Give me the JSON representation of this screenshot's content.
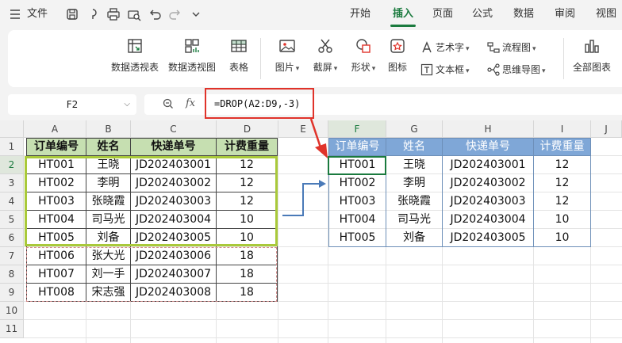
{
  "menubar": {
    "file_label": "文件",
    "tabs": [
      "开始",
      "插入",
      "页面",
      "公式",
      "数据",
      "审阅",
      "视图"
    ],
    "active_tab": "插入"
  },
  "ribbon": {
    "pivot_table": "数据透视表",
    "pivot_chart": "数据透视图",
    "table": "表格",
    "picture": "图片",
    "screenshot": "截屏",
    "shape": "形状",
    "icon": "图标",
    "wordart": "艺术字",
    "textbox": "文本框",
    "flowchart": "流程图",
    "mindmap": "思维导图",
    "all_charts": "全部图表"
  },
  "formula_bar": {
    "name_box": "F2",
    "fx_label": "fx",
    "formula": "=DROP(A2:D9,-3)"
  },
  "sheet": {
    "columns": [
      "A",
      "B",
      "C",
      "D",
      "E",
      "F",
      "G",
      "H",
      "I",
      "J"
    ],
    "rows": [
      "1",
      "2",
      "3",
      "4",
      "5",
      "6",
      "7",
      "8",
      "9",
      "10",
      "11"
    ],
    "headers": [
      "订单编号",
      "姓名",
      "快递单号",
      "计费重量"
    ],
    "source_rows": [
      [
        "HT001",
        "王晓",
        "JD202403001",
        "12"
      ],
      [
        "HT002",
        "李明",
        "JD202403002",
        "12"
      ],
      [
        "HT003",
        "张晓霞",
        "JD202403003",
        "12"
      ],
      [
        "HT004",
        "司马光",
        "JD202403004",
        "10"
      ],
      [
        "HT005",
        "刘备",
        "JD202403005",
        "10"
      ],
      [
        "HT006",
        "张大光",
        "JD202403006",
        "18"
      ],
      [
        "HT007",
        "刘一手",
        "JD202403007",
        "18"
      ],
      [
        "HT008",
        "宋志强",
        "JD202403008",
        "18"
      ]
    ],
    "result_rows": [
      [
        "HT001",
        "王晓",
        "JD202403001",
        "12"
      ],
      [
        "HT002",
        "李明",
        "JD202403002",
        "12"
      ],
      [
        "HT003",
        "张晓霞",
        "JD202403003",
        "12"
      ],
      [
        "HT004",
        "司马光",
        "JD202403004",
        "10"
      ],
      [
        "HT005",
        "刘备",
        "JD202403005",
        "10"
      ]
    ]
  },
  "colors": {
    "accent": "#1a7a3e",
    "source_header": "#c6dfb1",
    "result_header": "#7fa7d7",
    "highlight_green": "#a9c93a",
    "callout_red": "#e0332a",
    "arrow_blue": "#4a7ab8"
  }
}
